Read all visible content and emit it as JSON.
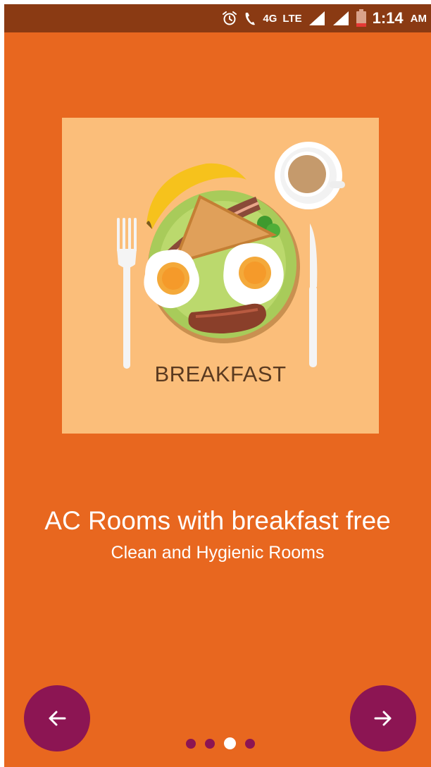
{
  "statusbar": {
    "network_4g": "4G",
    "network_lte": "LTE",
    "time": "1:14",
    "ampm": "AM",
    "icons": [
      "alarm-icon",
      "wifi-calling-icon",
      "signal-icon",
      "signal-icon",
      "battery-icon"
    ]
  },
  "slide": {
    "illustration_label": "BREAKFAST",
    "title": "AC Rooms with breakfast free",
    "subtitle": "Clean and Hygienic Rooms"
  },
  "nav": {
    "prev_icon": "arrow-left-icon",
    "next_icon": "arrow-right-icon"
  },
  "pagination": {
    "total": 4,
    "active_index": 2
  },
  "colors": {
    "background": "#E8671F",
    "statusbar": "#8A3A13",
    "illustration_bg": "#FBBE7A",
    "button": "#8C1553"
  }
}
